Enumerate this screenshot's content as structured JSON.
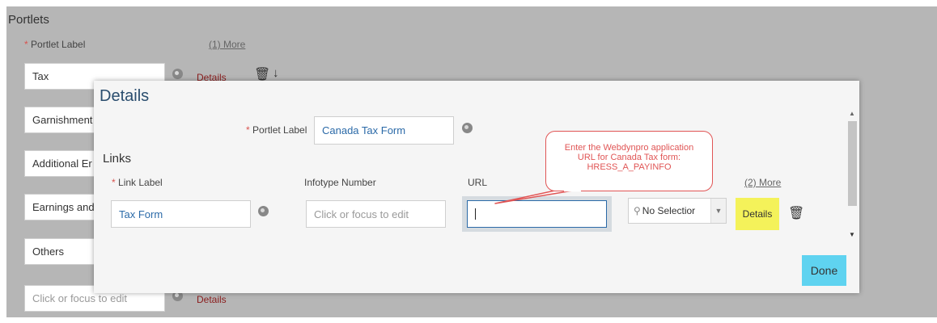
{
  "background": {
    "section_title": "Portlets",
    "portlet_label_header": "Portlet Label",
    "more_link": "(1) More",
    "portlets": [
      {
        "label": "Tax",
        "details": "Details"
      },
      {
        "label": "Garnishment"
      },
      {
        "label": "Additional Er"
      },
      {
        "label": "Earnings and"
      },
      {
        "label": "Others"
      },
      {
        "placeholder": "Click or focus to edit",
        "details": "Details"
      }
    ]
  },
  "dialog": {
    "title": "Details",
    "portlet_label": "Portlet Label",
    "portlet_value": "Canada Tax Form",
    "links_heading": "Links",
    "columns": {
      "link_label": "Link Label",
      "infotype": "Infotype Number",
      "url": "URL",
      "more": "(2) More"
    },
    "row": {
      "link_value": "Tax Form",
      "infotype_placeholder": "Click or focus to edit",
      "url_value": "",
      "dropdown_value": "No Selectior",
      "details": "Details"
    },
    "done_label": "Done"
  },
  "callout": {
    "line1": "Enter the Webdynpro application",
    "line2": "URL for Canada Tax form:",
    "line3": "HRESS_A_PAYINFO"
  },
  "required_marker": "*",
  "colors": {
    "accent_blue": "#2b6aa8",
    "done_button": "#5fd3f0",
    "highlight": "#f4f25a",
    "callout_red": "#e05555"
  }
}
